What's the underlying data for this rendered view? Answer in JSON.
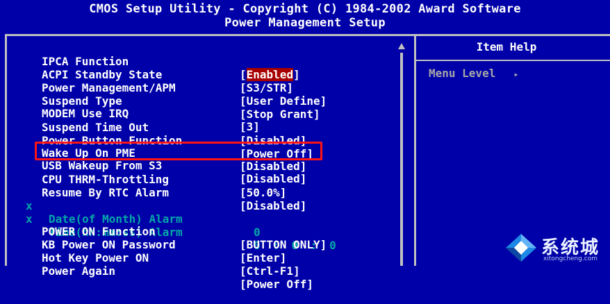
{
  "header": {
    "line1": "CMOS Setup Utility - Copyright (C) 1984-2002 Award Software",
    "line2": "Power Management Setup"
  },
  "settings": [
    {
      "marker": "",
      "label": "IPCA Function",
      "value_open": "[",
      "value_hl": "Enabled",
      "value_close": "]",
      "disabled": false
    },
    {
      "marker": "",
      "label": "ACPI Standby State",
      "value": "[S3/STR]",
      "disabled": false
    },
    {
      "marker": "",
      "label": "Power Management/APM",
      "value": "[User Define]",
      "disabled": false
    },
    {
      "marker": "",
      "label": "Suspend Type",
      "value": "[Stop Grant]",
      "disabled": false
    },
    {
      "marker": "",
      "label": "MODEM Use IRQ",
      "value": "[3]",
      "disabled": false
    },
    {
      "marker": "",
      "label": "Suspend Time Out",
      "value": "[Disabled]",
      "disabled": false
    },
    {
      "marker": "",
      "label": "Power Button Function",
      "value": "[Power Off]",
      "disabled": false
    },
    {
      "marker": "",
      "label": "Wake Up On PME",
      "value": "[Disabled]",
      "disabled": false
    },
    {
      "marker": "",
      "label": "USB Wakeup From S3",
      "value": "[Disabled]",
      "disabled": false
    },
    {
      "marker": "",
      "label": "CPU THRM-Throttling",
      "value": "[50.0%]",
      "disabled": false
    },
    {
      "marker": "",
      "label": "Resume By RTC Alarm",
      "value": "[Disabled]",
      "disabled": false
    },
    {
      "marker": "x",
      "label": "Date(of Month) Alarm",
      "value": "0",
      "disabled": true
    },
    {
      "marker": "x",
      "label": "Time(hh:mm:ss) Alarm",
      "value": "0 : 0 : 0",
      "disabled": true
    },
    {
      "marker": "",
      "label": "POWER ON Function",
      "value": "[BUTTON ONLY]",
      "disabled": false
    },
    {
      "marker": "",
      "label": "KB Power ON Password",
      "value": "[Enter]",
      "disabled": false
    },
    {
      "marker": "",
      "label": "Hot Key Power ON",
      "value": "[Ctrl-F1]",
      "disabled": false
    },
    {
      "marker": "",
      "label": "Power Again",
      "value": "[Power Off]",
      "disabled": false
    }
  ],
  "help": {
    "title": "Item Help",
    "menu_level": "Menu Level",
    "menu_level_arrow": "▸"
  },
  "watermark": {
    "text": "系统城",
    "url": "xitongcheng.com"
  },
  "colors": {
    "background": "#0000a8",
    "text": "#ffffff",
    "disabled_text": "#00a8a8",
    "selection": "#a80000",
    "annotation": "#ff1414",
    "frame": "#c0c0c0"
  }
}
